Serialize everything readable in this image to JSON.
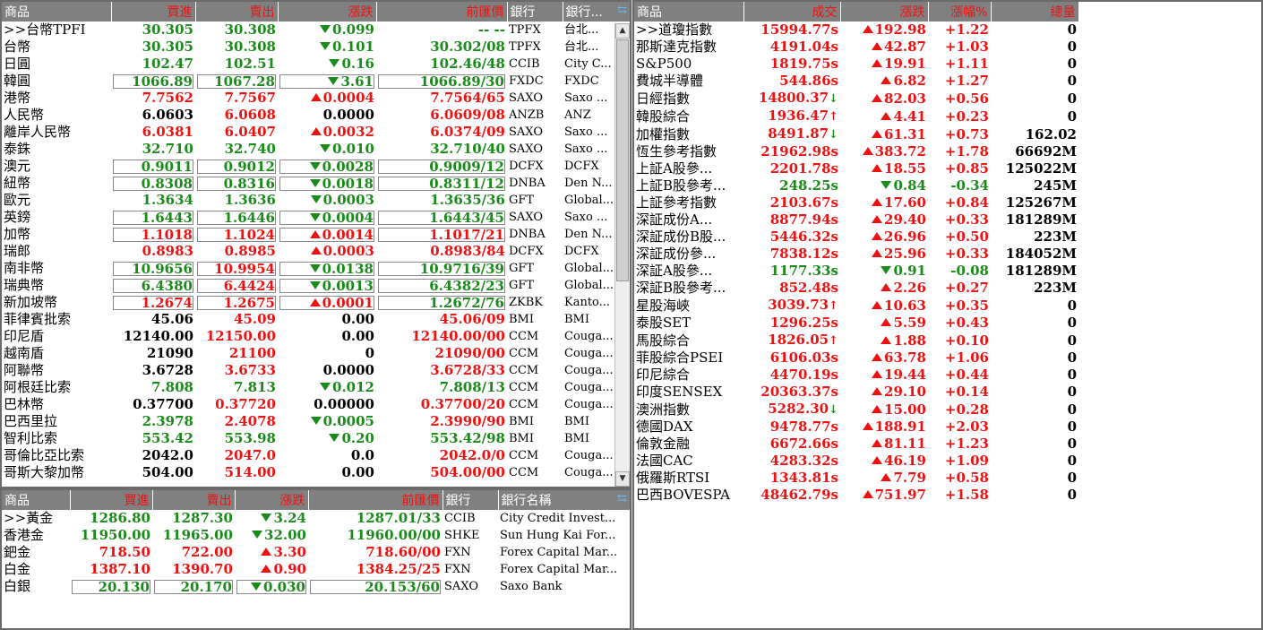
{
  "fx": {
    "headers": [
      "商品",
      "買進",
      "賣出",
      "漲跌",
      "前匯價",
      "銀行",
      "銀行..."
    ],
    "rows": [
      {
        "name": ">>台幣TPFI",
        "buy": "30.305",
        "sell": "30.308",
        "chg": "0.099",
        "dir": "dn",
        "prev": "-- --",
        "bank": "TPFX",
        "bankname": "台北...",
        "color": "g"
      },
      {
        "name": "台幣",
        "buy": "30.305",
        "sell": "30.308",
        "chg": "0.101",
        "dir": "dn",
        "prev": "30.302/08",
        "bank": "TPFX",
        "bankname": "台北...",
        "color": "g"
      },
      {
        "name": "日圓",
        "buy": "102.47",
        "sell": "102.51",
        "chg": "0.16",
        "dir": "dn",
        "prev": "102.46/48",
        "bank": "CCIB",
        "bankname": "City C...",
        "color": "g"
      },
      {
        "name": "韓圓",
        "buy": "1066.89",
        "sell": "1067.28",
        "chg": "3.61",
        "dir": "dn",
        "prev": "1066.89/30",
        "bank": "FXDC",
        "bankname": "FXDC",
        "color": "g",
        "hl": true
      },
      {
        "name": "港幣",
        "buy": "7.7562",
        "sell": "7.7567",
        "chg": "0.0004",
        "dir": "up",
        "prev": "7.7564/65",
        "bank": "SAXO",
        "bankname": "Saxo ...",
        "color": "r"
      },
      {
        "name": "人民幣",
        "buy": "6.0603",
        "sell": "6.0608",
        "chg": "0.0000",
        "dir": "",
        "prev": "6.0609/08",
        "bank": "ANZB",
        "bankname": "ANZ",
        "color": "mix1"
      },
      {
        "name": "離岸人民幣",
        "buy": "6.0381",
        "sell": "6.0407",
        "chg": "0.0032",
        "dir": "up",
        "prev": "6.0374/09",
        "bank": "SAXO",
        "bankname": "Saxo ...",
        "color": "r"
      },
      {
        "name": "泰銖",
        "buy": "32.710",
        "sell": "32.740",
        "chg": "0.010",
        "dir": "dn",
        "prev": "32.710/40",
        "bank": "SAXO",
        "bankname": "Saxo ...",
        "color": "g"
      },
      {
        "name": "澳元",
        "buy": "0.9011",
        "sell": "0.9012",
        "chg": "0.0028",
        "dir": "dn",
        "prev": "0.9009/12",
        "bank": "DCFX",
        "bankname": "DCFX",
        "color": "g",
        "hl": true
      },
      {
        "name": "紐幣",
        "buy": "0.8308",
        "sell": "0.8316",
        "chg": "0.0018",
        "dir": "dn",
        "prev": "0.8311/12",
        "bank": "DNBA",
        "bankname": "Den N...",
        "color": "g",
        "hl": true
      },
      {
        "name": "歐元",
        "buy": "1.3634",
        "sell": "1.3636",
        "chg": "0.0003",
        "dir": "dn",
        "prev": "1.3635/36",
        "bank": "GFT",
        "bankname": "Global...",
        "color": "g"
      },
      {
        "name": "英鎊",
        "buy": "1.6443",
        "sell": "1.6446",
        "chg": "0.0004",
        "dir": "dn",
        "prev": "1.6443/45",
        "bank": "SAXO",
        "bankname": "Saxo ...",
        "color": "g",
        "hl": true
      },
      {
        "name": "加幣",
        "buy": "1.1018",
        "sell": "1.1024",
        "chg": "0.0014",
        "dir": "up",
        "prev": "1.1017/21",
        "bank": "DNBA",
        "bankname": "Den N...",
        "color": "r",
        "hl": true
      },
      {
        "name": "瑞郎",
        "buy": "0.8983",
        "sell": "0.8985",
        "chg": "0.0003",
        "dir": "up",
        "prev": "0.8983/84",
        "bank": "DCFX",
        "bankname": "DCFX",
        "color": "r"
      },
      {
        "name": "南非幣",
        "buy": "10.9656",
        "sell": "10.9954",
        "chg": "0.0138",
        "dir": "dn",
        "prev": "10.9716/39",
        "bank": "GFT",
        "bankname": "Global...",
        "color": "mix2",
        "hl": true
      },
      {
        "name": "瑞典幣",
        "buy": "6.4380",
        "sell": "6.4424",
        "chg": "0.0013",
        "dir": "dn",
        "prev": "6.4382/23",
        "bank": "GFT",
        "bankname": "Global...",
        "color": "mix2",
        "hl": true
      },
      {
        "name": "新加坡幣",
        "buy": "1.2674",
        "sell": "1.2675",
        "chg": "0.0001",
        "dir": "up",
        "prev": "1.2672/76",
        "bank": "ZKBK",
        "bankname": "Kanto...",
        "color": "mix3",
        "hl": true
      },
      {
        "name": "菲律賓批索",
        "buy": "45.06",
        "sell": "45.09",
        "chg": "0.00",
        "dir": "",
        "prev": "45.06/09",
        "bank": "BMI",
        "bankname": "BMI",
        "color": "mix1"
      },
      {
        "name": "印尼盾",
        "buy": "12140.00",
        "sell": "12150.00",
        "chg": "0.00",
        "dir": "",
        "prev": "12140.00/00",
        "bank": "CCM",
        "bankname": "Couga...",
        "color": "mix1"
      },
      {
        "name": "越南盾",
        "buy": "21090",
        "sell": "21100",
        "chg": "0",
        "dir": "",
        "prev": "21090/00",
        "bank": "CCM",
        "bankname": "Couga...",
        "color": "mix1"
      },
      {
        "name": "阿聯幣",
        "buy": "3.6728",
        "sell": "3.6733",
        "chg": "0.0000",
        "dir": "",
        "prev": "3.6728/33",
        "bank": "CCM",
        "bankname": "Couga...",
        "color": "mix1"
      },
      {
        "name": "阿根廷比索",
        "buy": "7.808",
        "sell": "7.813",
        "chg": "0.012",
        "dir": "dn",
        "prev": "7.808/13",
        "bank": "CCM",
        "bankname": "Couga...",
        "color": "g"
      },
      {
        "name": "巴林幣",
        "buy": "0.37700",
        "sell": "0.37720",
        "chg": "0.00000",
        "dir": "",
        "prev": "0.37700/20",
        "bank": "CCM",
        "bankname": "Couga...",
        "color": "mix1"
      },
      {
        "name": "巴西里拉",
        "buy": "2.3978",
        "sell": "2.4078",
        "chg": "0.0005",
        "dir": "dn",
        "prev": "2.3990/90",
        "bank": "BMI",
        "bankname": "BMI",
        "color": "mix4"
      },
      {
        "name": "智利比索",
        "buy": "553.42",
        "sell": "553.98",
        "chg": "0.20",
        "dir": "dn",
        "prev": "553.42/98",
        "bank": "BMI",
        "bankname": "BMI",
        "color": "g"
      },
      {
        "name": "哥倫比亞比索",
        "buy": "2042.0",
        "sell": "2047.0",
        "chg": "0.0",
        "dir": "",
        "prev": "2042.0/0",
        "bank": "CCM",
        "bankname": "Couga...",
        "color": "mix1"
      },
      {
        "name": "哥斯大黎加幣",
        "buy": "504.00",
        "sell": "514.00",
        "chg": "0.00",
        "dir": "",
        "prev": "504.00/00",
        "bank": "CCM",
        "bankname": "Couga...",
        "color": "mix1"
      }
    ]
  },
  "metals": {
    "headers": [
      "商品",
      "買進",
      "賣出",
      "漲跌",
      "前匯價",
      "銀行",
      "銀行名稱"
    ],
    "rows": [
      {
        "name": ">>黃金",
        "buy": "1286.80",
        "sell": "1287.30",
        "chg": "3.24",
        "dir": "dn",
        "prev": "1287.01/33",
        "bank": "CCIB",
        "bankname": "City Credit Invest...",
        "color": "g"
      },
      {
        "name": "香港金",
        "buy": "11950.00",
        "sell": "11965.00",
        "chg": "32.00",
        "dir": "dn",
        "prev": "11960.00/00",
        "bank": "SHKE",
        "bankname": "Sun Hung Kai For...",
        "color": "g"
      },
      {
        "name": "鈀金",
        "buy": "718.50",
        "sell": "722.00",
        "chg": "3.30",
        "dir": "up",
        "prev": "718.60/00",
        "bank": "FXN",
        "bankname": "Forex Capital Mar...",
        "color": "r"
      },
      {
        "name": "白金",
        "buy": "1387.10",
        "sell": "1390.70",
        "chg": "0.90",
        "dir": "up",
        "prev": "1384.25/25",
        "bank": "FXN",
        "bankname": "Forex Capital Mar...",
        "color": "r"
      },
      {
        "name": "白銀",
        "buy": "20.130",
        "sell": "20.170",
        "chg": "0.030",
        "dir": "dn",
        "prev": "20.153/60",
        "bank": "SAXO",
        "bankname": "Saxo Bank",
        "color": "g",
        "hl": true
      }
    ]
  },
  "idx": {
    "headers": [
      "商品",
      "成交",
      "漲跌",
      "漲幅%",
      "總量"
    ],
    "rows": [
      {
        "name": ">>道瓊指數",
        "price": "15994.77s",
        "chg": "192.98",
        "dir": "up",
        "pct": "+1.22",
        "vol": "0",
        "color": "r"
      },
      {
        "name": "那斯達克指數",
        "price": "4191.04s",
        "chg": "42.87",
        "dir": "up",
        "pct": "+1.03",
        "vol": "0",
        "color": "r"
      },
      {
        "name": "S&P500",
        "price": "1819.75s",
        "chg": "19.91",
        "dir": "up",
        "pct": "+1.11",
        "vol": "0",
        "color": "r"
      },
      {
        "name": "費城半導體",
        "price": "544.86s",
        "chg": "6.82",
        "dir": "up",
        "pct": "+1.27",
        "vol": "0",
        "color": "r"
      },
      {
        "name": "日經指數",
        "price": "14800.37",
        "mark": "dn",
        "chg": "82.03",
        "dir": "up",
        "pct": "+0.56",
        "vol": "0",
        "color": "r"
      },
      {
        "name": "韓股綜合",
        "price": "1936.47",
        "mark": "up",
        "chg": "4.41",
        "dir": "up",
        "pct": "+0.23",
        "vol": "0",
        "color": "r"
      },
      {
        "name": "加權指數",
        "price": "8491.87",
        "mark": "dn",
        "chg": "61.31",
        "dir": "up",
        "pct": "+0.73",
        "vol": "162.02",
        "color": "r"
      },
      {
        "name": "恆生參考指數",
        "price": "21962.98s",
        "chg": "383.72",
        "dir": "up",
        "pct": "+1.78",
        "vol": "66692M",
        "color": "r"
      },
      {
        "name": "上証A股參...",
        "price": "2201.78s",
        "chg": "18.55",
        "dir": "up",
        "pct": "+0.85",
        "vol": "125022M",
        "color": "r"
      },
      {
        "name": "上証B股參考...",
        "price": "248.25s",
        "chg": "0.84",
        "dir": "dn",
        "pct": "-0.34",
        "vol": "245M",
        "color": "g"
      },
      {
        "name": "上証參考指數",
        "price": "2103.67s",
        "chg": "17.60",
        "dir": "up",
        "pct": "+0.84",
        "vol": "125267M",
        "color": "r"
      },
      {
        "name": "深証成份A...",
        "price": "8877.94s",
        "chg": "29.40",
        "dir": "up",
        "pct": "+0.33",
        "vol": "181289M",
        "color": "r"
      },
      {
        "name": "深証成份B股...",
        "price": "5446.32s",
        "chg": "26.96",
        "dir": "up",
        "pct": "+0.50",
        "vol": "223M",
        "color": "r"
      },
      {
        "name": "深証成份參...",
        "price": "7838.12s",
        "chg": "25.96",
        "dir": "up",
        "pct": "+0.33",
        "vol": "184052M",
        "color": "r"
      },
      {
        "name": "深証A股參...",
        "price": "1177.33s",
        "chg": "0.91",
        "dir": "dn",
        "pct": "-0.08",
        "vol": "181289M",
        "color": "g"
      },
      {
        "name": "深証B股參考...",
        "price": "852.48s",
        "chg": "2.26",
        "dir": "up",
        "pct": "+0.27",
        "vol": "223M",
        "color": "r"
      },
      {
        "name": "星股海峽",
        "price": "3039.73",
        "mark": "up",
        "chg": "10.63",
        "dir": "up",
        "pct": "+0.35",
        "vol": "0",
        "color": "r"
      },
      {
        "name": "泰股SET",
        "price": "1296.25s",
        "chg": "5.59",
        "dir": "up",
        "pct": "+0.43",
        "vol": "0",
        "color": "r"
      },
      {
        "name": "馬股綜合",
        "price": "1826.05",
        "mark": "up",
        "chg": "1.88",
        "dir": "up",
        "pct": "+0.10",
        "vol": "0",
        "color": "r"
      },
      {
        "name": "菲股綜合PSEI",
        "price": "6106.03s",
        "chg": "63.78",
        "dir": "up",
        "pct": "+1.06",
        "vol": "0",
        "color": "r"
      },
      {
        "name": "印尼綜合",
        "price": "4470.19s",
        "chg": "19.44",
        "dir": "up",
        "pct": "+0.44",
        "vol": "0",
        "color": "r"
      },
      {
        "name": "印度SENSEX",
        "price": "20363.37s",
        "chg": "29.10",
        "dir": "up",
        "pct": "+0.14",
        "vol": "0",
        "color": "r"
      },
      {
        "name": "澳洲指數",
        "price": "5282.30",
        "mark": "dn",
        "chg": "15.00",
        "dir": "up",
        "pct": "+0.28",
        "vol": "0",
        "color": "r"
      },
      {
        "name": "德國DAX",
        "price": "9478.77s",
        "chg": "188.91",
        "dir": "up",
        "pct": "+2.03",
        "vol": "0",
        "color": "r"
      },
      {
        "name": "倫敦金融",
        "price": "6672.66s",
        "chg": "81.11",
        "dir": "up",
        "pct": "+1.23",
        "vol": "0",
        "color": "r"
      },
      {
        "name": "法國CAC",
        "price": "4283.32s",
        "chg": "46.19",
        "dir": "up",
        "pct": "+1.09",
        "vol": "0",
        "color": "r"
      },
      {
        "name": "俄羅斯RTSI",
        "price": "1343.81s",
        "chg": "7.79",
        "dir": "up",
        "pct": "+0.58",
        "vol": "0",
        "color": "r"
      },
      {
        "name": "巴西BOVESPA",
        "price": "48462.79s",
        "chg": "751.97",
        "dir": "up",
        "pct": "+1.58",
        "vol": "0",
        "color": "r"
      }
    ]
  },
  "colors": {
    "up": "#ee1111",
    "down": "#1a8a1a",
    "header": "#808080"
  }
}
